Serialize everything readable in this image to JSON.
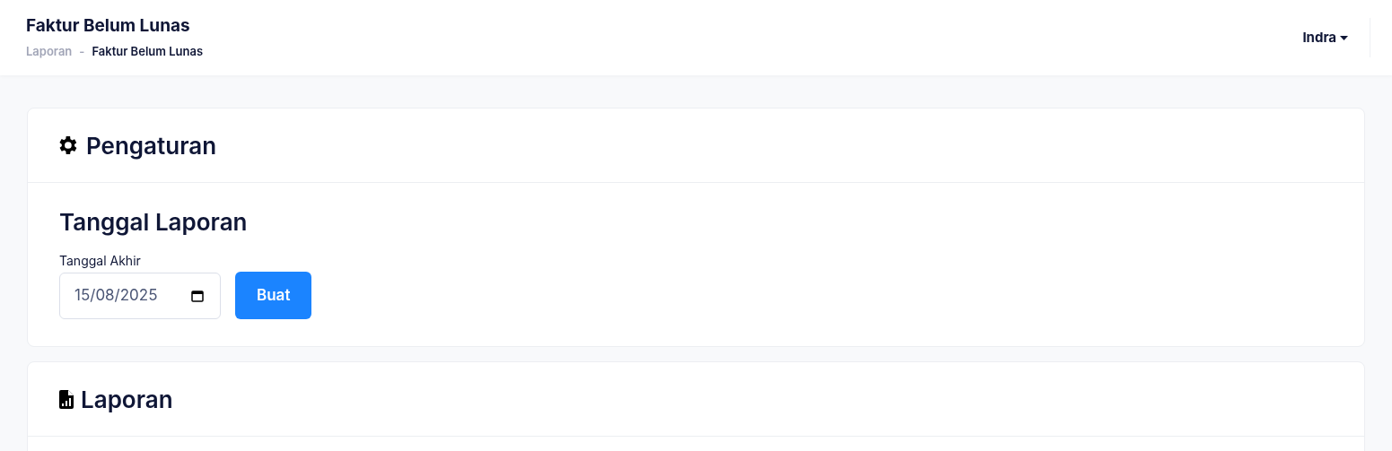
{
  "header": {
    "title": "Faktur Belum Lunas",
    "breadcrumb": [
      {
        "label": "Laporan",
        "current": false
      },
      {
        "label": "Faktur Belum Lunas",
        "current": true
      }
    ],
    "separator": "-",
    "user": "Indra"
  },
  "settings_card": {
    "title": "Pengaturan",
    "section_title": "Tanggal Laporan",
    "field_label": "Tanggal Akhir",
    "date_value": "15/08/2025",
    "button": "Buat"
  },
  "report_card": {
    "title": "Laporan"
  }
}
